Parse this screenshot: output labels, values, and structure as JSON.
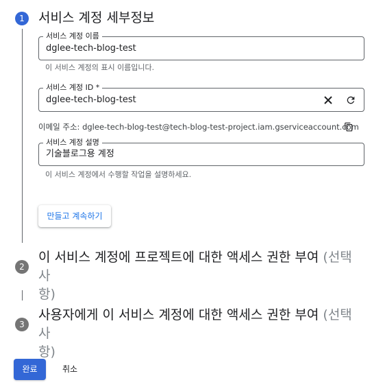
{
  "colors": {
    "accent": "#3367d6",
    "link": "#1a73e8",
    "inactive_step": "#757575",
    "optional_text": "#80868b"
  },
  "step1": {
    "number": "1",
    "title": "서비스 계정 세부정보",
    "name_field": {
      "label": "서비스 계정 이름",
      "value": "dglee-tech-blog-test",
      "hint": "이 서비스 계정의 표시 이름입니다."
    },
    "id_field": {
      "label": "서비스 계정 ID *",
      "value": "dglee-tech-blog-test",
      "clear_icon": "close-icon",
      "refresh_icon": "refresh-icon"
    },
    "email": {
      "text": "이메일 주소: dglee-tech-blog-test@tech-blog-test-project.iam.gserviceaccount.com",
      "copy_icon": "copy-icon"
    },
    "description_field": {
      "label": "서비스 계정 설명",
      "value": "기술블로그용 계정",
      "hint": "이 서비스 계정에서 수행할 작업을 설명하세요."
    },
    "create_button": "만들고 계속하기"
  },
  "step2": {
    "number": "2",
    "title_line1": "이 서비스 계정에 프로젝트에 대한 액세스 권한 부여 ",
    "optional_line1": "(선택사",
    "optional_line2": "항)"
  },
  "step3": {
    "number": "3",
    "title_line1": "사용자에게 이 서비스 계정에 대한 액세스 권한 부여 ",
    "optional_line1": "(선택사",
    "optional_line2": "항)"
  },
  "footer": {
    "done_button": "완료",
    "cancel_button": "취소"
  }
}
